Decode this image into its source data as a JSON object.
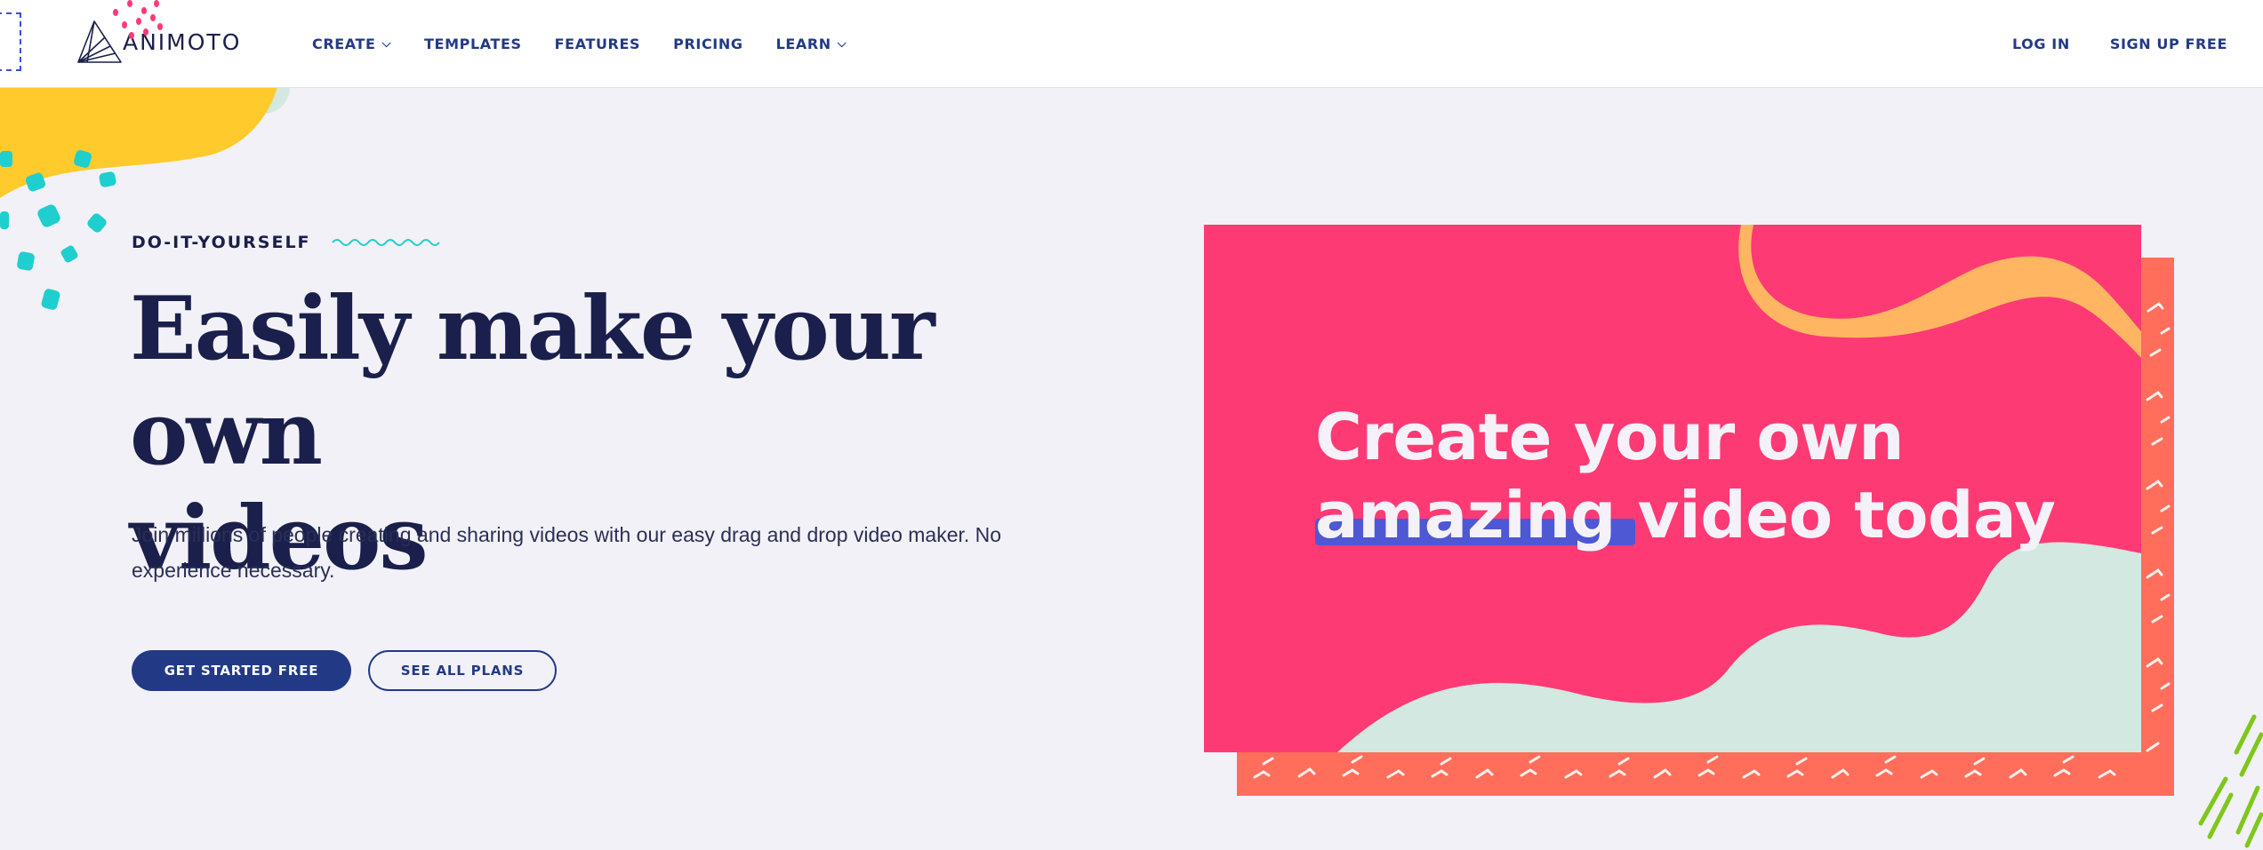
{
  "header": {
    "logo_text": "ANIMOTO",
    "nav": [
      {
        "label": "CREATE",
        "has_dropdown": true
      },
      {
        "label": "TEMPLATES",
        "has_dropdown": false
      },
      {
        "label": "FEATURES",
        "has_dropdown": false
      },
      {
        "label": "PRICING",
        "has_dropdown": false
      },
      {
        "label": "LEARN",
        "has_dropdown": true
      }
    ],
    "login_label": "LOG IN",
    "signup_label": "SIGN UP FREE"
  },
  "hero": {
    "eyebrow": "DO-IT-YOURSELF",
    "headline_line1": "Easily make your own",
    "headline_line2": "videos",
    "subtext": "Join millions of people creating and sharing videos with our easy drag and drop video maker. No experience necessary.",
    "primary_button": "GET STARTED FREE",
    "secondary_button": "SEE ALL PLANS"
  },
  "video_card": {
    "line1": "Create your own",
    "highlight": "amazing",
    "line2_rest": " video today"
  },
  "colors": {
    "background": "#f2f1f7",
    "navy": "#1b1f4b",
    "brand_blue": "#223a86",
    "card_pink": "#fe3a74",
    "card_coral": "#fe6e5b",
    "wave_mint": "#d2e8e1",
    "ribbon_orange": "#ffb562",
    "accent_yellow": "#ffca2c",
    "accent_teal": "#1fcfcf",
    "accent_green": "#7fc71b"
  },
  "icons": {
    "dropdown": "chevron-down-icon",
    "logo": "animoto-logo-icon"
  }
}
